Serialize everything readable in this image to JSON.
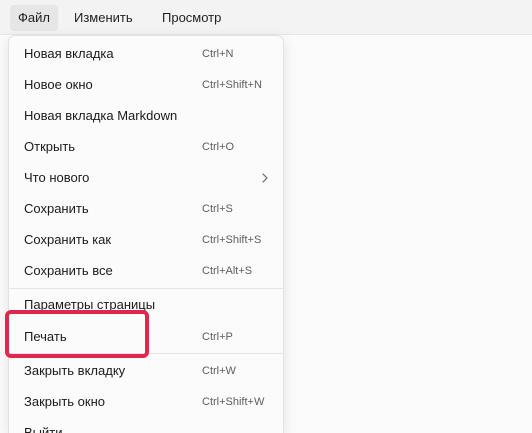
{
  "menubar": {
    "file": "Файл",
    "edit": "Изменить",
    "view": "Просмотр"
  },
  "file_menu": {
    "items": [
      {
        "label": "Новая вкладка",
        "shortcut": "Ctrl+N"
      },
      {
        "label": "Новое окно",
        "shortcut": "Ctrl+Shift+N"
      },
      {
        "label": "Новая вкладка Markdown",
        "shortcut": ""
      },
      {
        "label": "Открыть",
        "shortcut": "Ctrl+O"
      },
      {
        "label": "Что нового",
        "shortcut": "",
        "submenu_icon": "chevron-right-icon"
      },
      {
        "label": "Сохранить",
        "shortcut": "Ctrl+S"
      },
      {
        "label": "Сохранить как",
        "shortcut": "Ctrl+Shift+S"
      },
      {
        "label": "Сохранить все",
        "shortcut": "Ctrl+Alt+S"
      },
      {
        "label": "Параметры страницы",
        "shortcut": ""
      },
      {
        "label": "Печать",
        "shortcut": "Ctrl+P"
      },
      {
        "label": "Закрыть вкладку",
        "shortcut": "Ctrl+W"
      },
      {
        "label": "Закрыть окно",
        "shortcut": "Ctrl+Shift+W"
      },
      {
        "label": "Выйти",
        "shortcut": ""
      }
    ]
  },
  "highlight": {
    "target": "Печать",
    "color": "#e0284f"
  }
}
